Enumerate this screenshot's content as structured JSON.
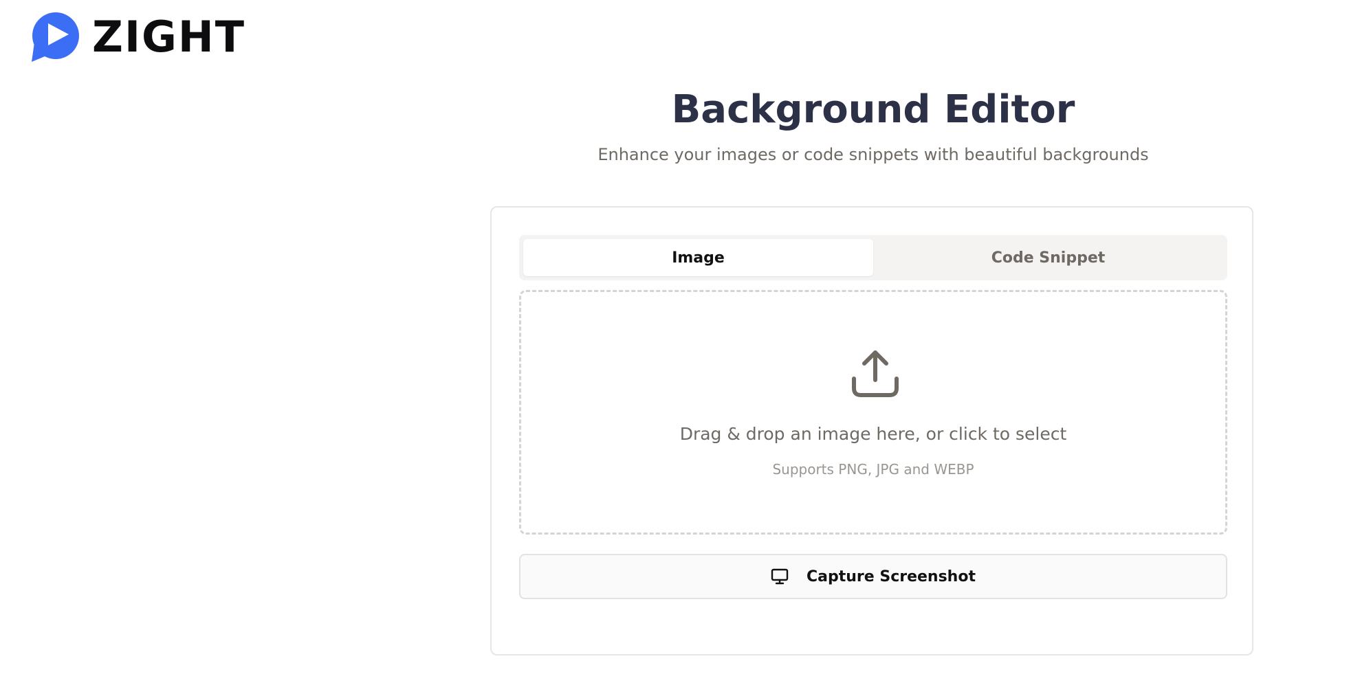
{
  "brand": {
    "name": "ZIGHT",
    "accent_color": "#3B6EF5",
    "logo_icon": "zight-play-bubble-icon"
  },
  "header": {
    "title": "Background Editor",
    "subtitle": "Enhance your images or code snippets with beautiful backgrounds"
  },
  "tabs": [
    {
      "label": "Image",
      "active": true
    },
    {
      "label": "Code Snippet",
      "active": false
    }
  ],
  "dropzone": {
    "icon": "upload-icon",
    "text": "Drag & drop an image here, or click to select",
    "hint": "Supports PNG, JPG and WEBP"
  },
  "capture": {
    "icon": "monitor-icon",
    "label": "Capture Screenshot"
  }
}
